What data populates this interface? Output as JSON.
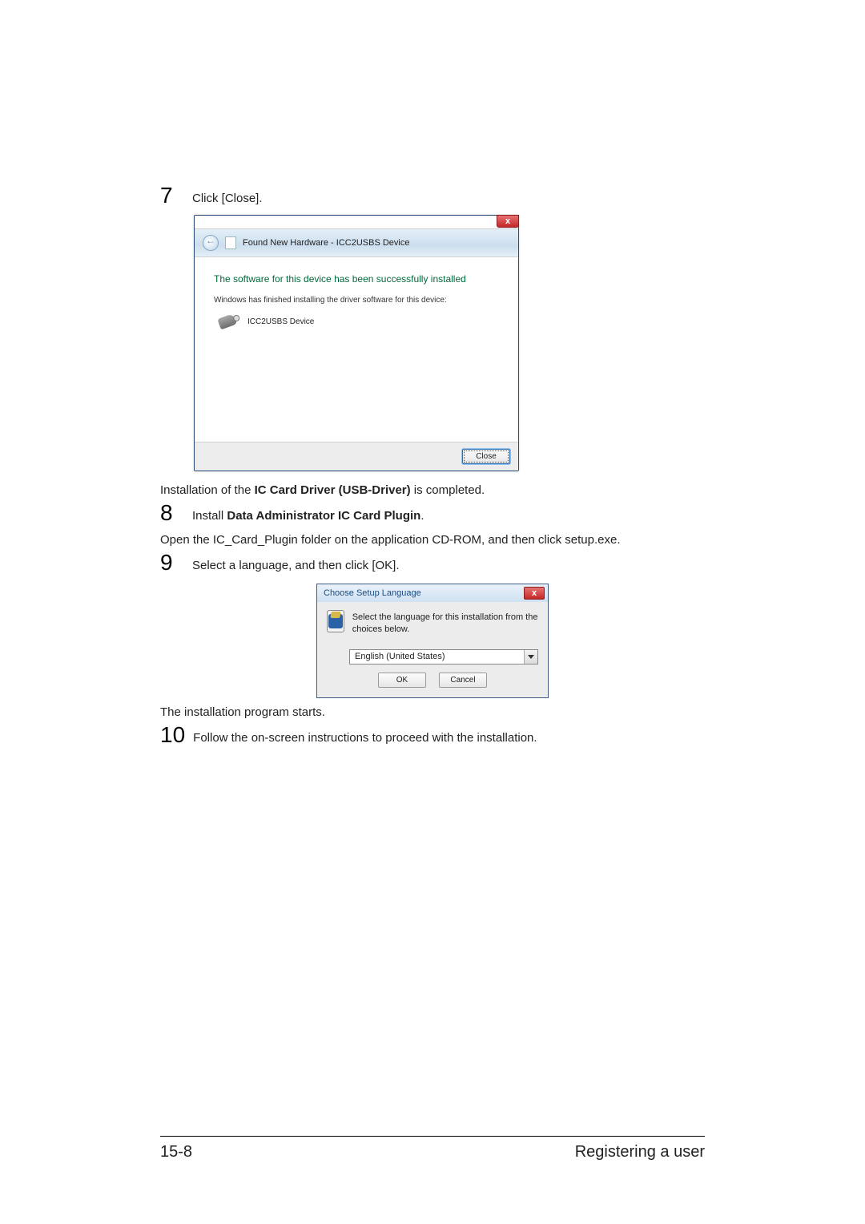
{
  "step7": {
    "num": "7",
    "text": "Click [Close]."
  },
  "wizard": {
    "close_x": "x",
    "title": "Found New Hardware - ICC2USBS Device",
    "heading": "The software for this device has been successfully installed",
    "subtext": "Windows has finished installing the driver software for this device:",
    "device_name": "ICC2USBS Device",
    "close_btn": "Close"
  },
  "line_install_completed_pre": "Installation of the ",
  "line_install_completed_bold": "IC Card Driver (USB-Driver)",
  "line_install_completed_post": " is completed.",
  "step8": {
    "num": "8",
    "text_pre": "Install ",
    "text_bold": "Data Administrator IC Card Plugin",
    "text_post": "."
  },
  "line_open_plugin": "Open the IC_Card_Plugin folder on the application CD-ROM, and then click setup.exe.",
  "step9": {
    "num": "9",
    "text": "Select a language, and then click [OK]."
  },
  "lang_dialog": {
    "title": "Choose Setup Language",
    "close_x": "x",
    "message": "Select the language for this installation from the choices below.",
    "selected": "English (United States)",
    "ok": "OK",
    "cancel": "Cancel"
  },
  "line_install_starts": "The installation program starts.",
  "step10": {
    "num": "10",
    "text": "Follow the on-screen instructions to proceed with the installation."
  },
  "footer": {
    "page": "15-8",
    "section": "Registering a user"
  }
}
